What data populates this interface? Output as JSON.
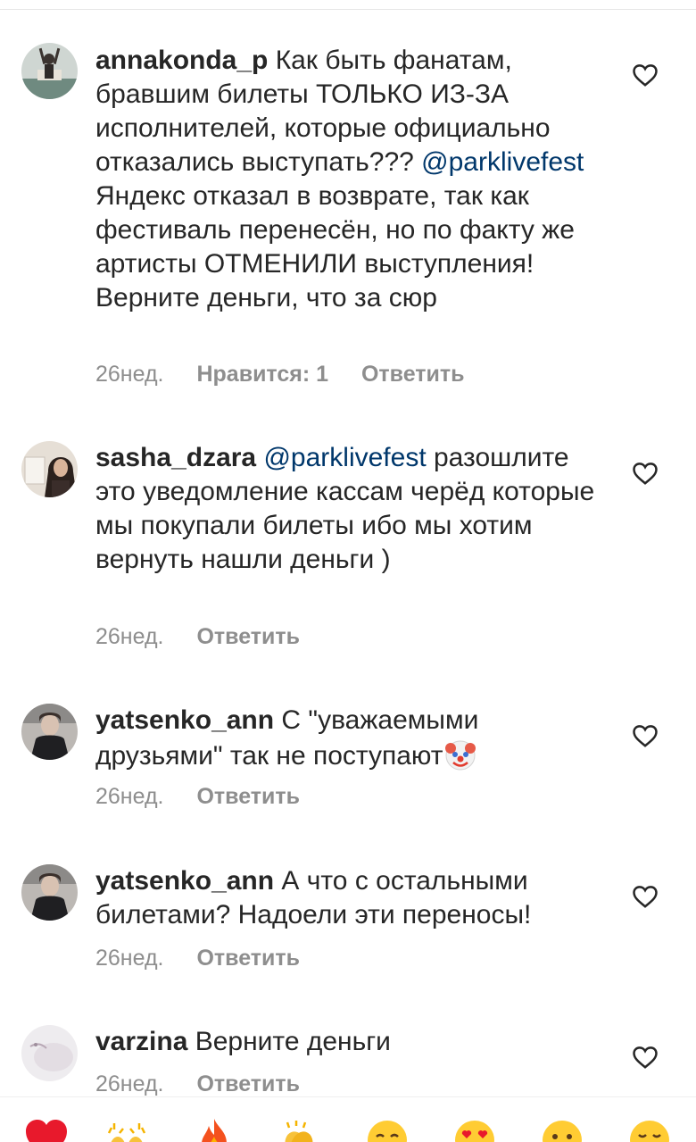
{
  "comments": [
    {
      "username": "annakonda_p",
      "text1": " Как быть фанатам, бравшим билеты ТОЛЬКО ИЗ-ЗА исполнителей, которые официально отказались выступать??? ",
      "mention": "@parklivefest",
      "text2": " Яндекс отказал в возврате, так как фестиваль перенесён, но по факту же артисты ОТМЕНИЛИ выступления! Верните деньги, что за сюр",
      "time": "26нед.",
      "likes": "Нравится: 1",
      "reply": "Ответить"
    },
    {
      "username": "sasha_dzara",
      "mention": "@parklivefest",
      "text2": " разошлите это уведомление кассам черёд которые мы покупали билеты ибо мы хотим вернуть нашли деньги )",
      "time": "26нед.",
      "reply": "Ответить"
    },
    {
      "username": "yatsenko_ann",
      "text1": " С \"уважаемыми друзьями\" так не поступают",
      "emoji": "clown-face-icon",
      "time": "26нед.",
      "reply": "Ответить"
    },
    {
      "username": "yatsenko_ann",
      "text1": " А что с остальными билетами? Надоели эти переносы!",
      "time": "26нед.",
      "reply": "Ответить"
    },
    {
      "username": "varzina",
      "text1": " Верните деньги",
      "time": "26нед.",
      "reply": "Ответить"
    }
  ],
  "reactions": [
    "red-heart-icon",
    "raising-hands-icon",
    "fire-icon",
    "clapping-hands-icon",
    "crying-face-icon",
    "heart-eyes-icon",
    "astonished-face-icon",
    "laughing-face-icon"
  ],
  "colors": {
    "text": "#262626",
    "meta": "#8e8e8e",
    "mention": "#00376b",
    "heart_outline": "#262626"
  }
}
